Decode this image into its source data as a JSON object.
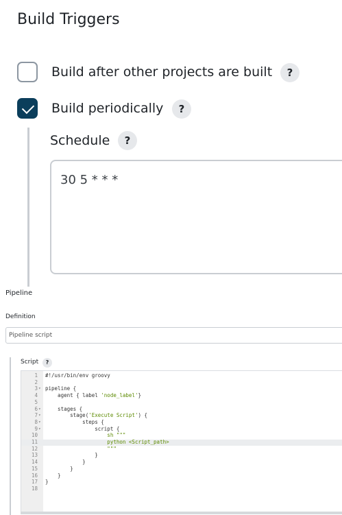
{
  "build_triggers": {
    "title": "Build Triggers",
    "options": [
      {
        "label": "Build after other projects are built",
        "checked": false,
        "help": "?"
      },
      {
        "label": "Build periodically",
        "checked": true,
        "help": "?"
      }
    ],
    "schedule": {
      "label": "Schedule",
      "help": "?",
      "value": "30 5 * * *"
    }
  },
  "pipeline": {
    "section_label": "Pipeline",
    "definition_label": "Definition",
    "definition_value": "Pipeline script",
    "script_label": "Script",
    "script_help": "?",
    "code": [
      {
        "n": "1",
        "fold": "",
        "text": "#!/usr/bin/env groovy"
      },
      {
        "n": "2",
        "fold": "",
        "text": ""
      },
      {
        "n": "3",
        "fold": "▾",
        "text": "pipeline {"
      },
      {
        "n": "4",
        "fold": "",
        "text": "    agent { label 'node_label'}"
      },
      {
        "n": "5",
        "fold": "",
        "text": ""
      },
      {
        "n": "6",
        "fold": "▾",
        "text": "    stages {"
      },
      {
        "n": "7",
        "fold": "▾",
        "text": "        stage('Execute Script') {"
      },
      {
        "n": "8",
        "fold": "▾",
        "text": "            steps {"
      },
      {
        "n": "9",
        "fold": "▾",
        "text": "                script {"
      },
      {
        "n": "10",
        "fold": "",
        "text": "                    sh \"\"\""
      },
      {
        "n": "11",
        "fold": "",
        "text": "                    python <Script_path>"
      },
      {
        "n": "12",
        "fold": "",
        "text": "                    \"\"\""
      },
      {
        "n": "13",
        "fold": "",
        "text": "                }"
      },
      {
        "n": "14",
        "fold": "",
        "text": "            }"
      },
      {
        "n": "15",
        "fold": "",
        "text": "        }"
      },
      {
        "n": "16",
        "fold": "",
        "text": "    }"
      },
      {
        "n": "17",
        "fold": "",
        "text": "}"
      },
      {
        "n": "18",
        "fold": "",
        "text": ""
      }
    ]
  },
  "colors": {
    "checkbox_checked": "#0b3e5b",
    "string_green": "#5c8a00"
  }
}
